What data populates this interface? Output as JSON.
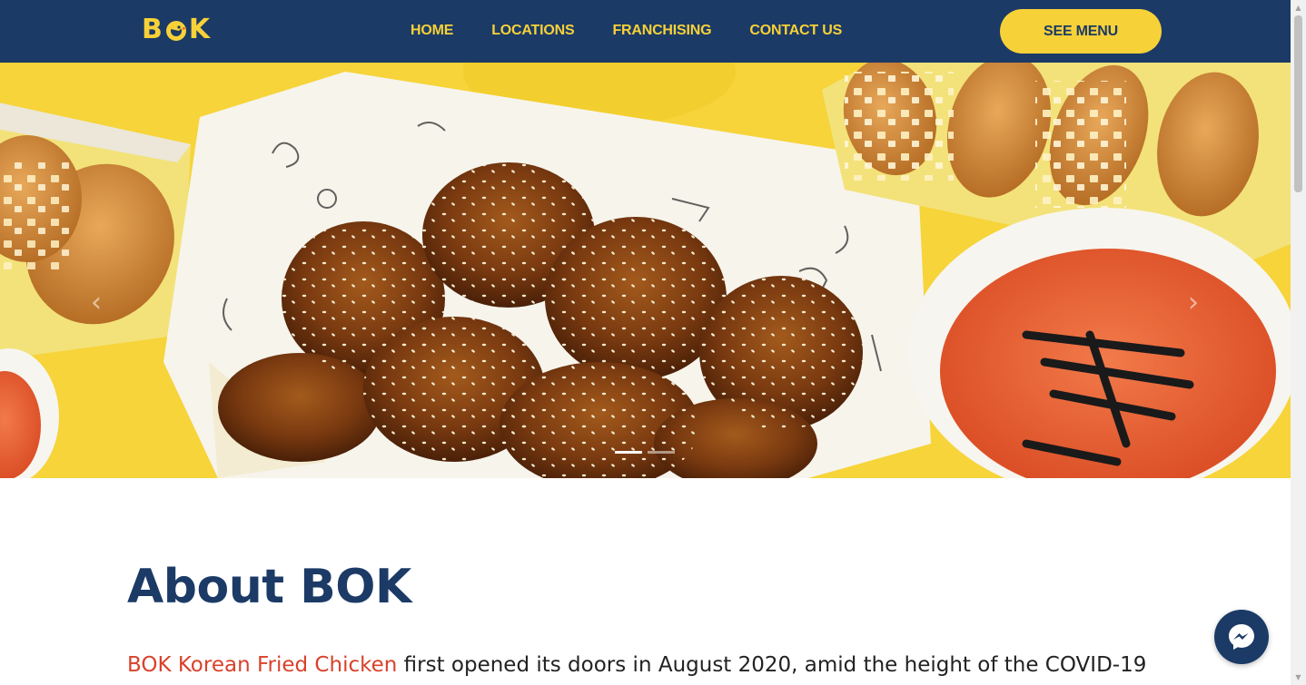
{
  "brand": {
    "logo_text_left": "B",
    "logo_text_right": "K"
  },
  "nav": {
    "links": [
      {
        "label": "HOME"
      },
      {
        "label": "LOCATIONS"
      },
      {
        "label": "FRANCHISING"
      },
      {
        "label": "CONTACT US"
      }
    ],
    "cta_label": "SEE MENU"
  },
  "hero": {
    "prev_glyph": "‹",
    "next_glyph": "›",
    "slide_count": 2,
    "active_slide": 1
  },
  "about": {
    "title": "About BOK",
    "brand_name": "BOK Korean Fried Chicken",
    "text": "first opened its doors in August 2020, amid the height of the COVID-19"
  },
  "colors": {
    "navy": "#1b3a66",
    "yellow": "#f7d138",
    "accent_red": "#d9412b"
  },
  "icons": [
    "chick-logo-icon",
    "chevron-left-icon",
    "chevron-right-icon",
    "messenger-icon"
  ]
}
